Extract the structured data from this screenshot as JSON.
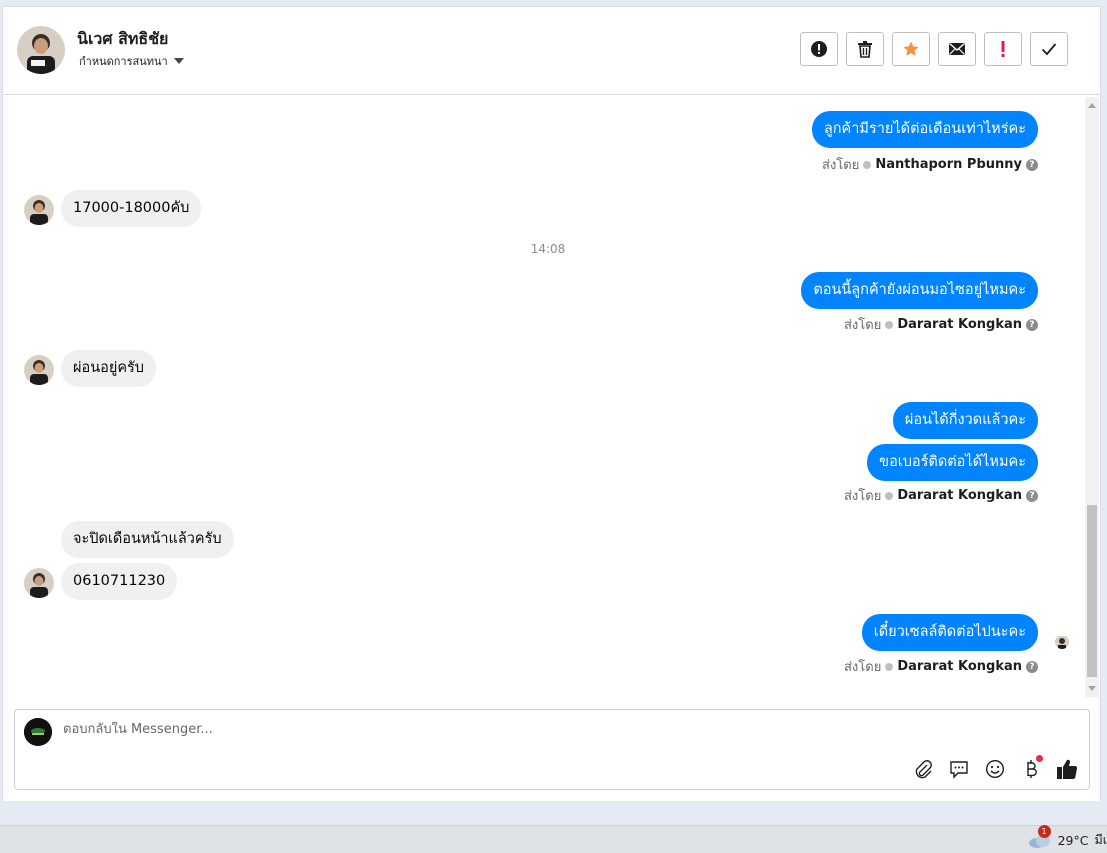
{
  "header": {
    "contact_name": "นิเวศ สิทธิชัย",
    "assign_label": "กำหนดการสนทนา",
    "actions": [
      {
        "name": "spam-report-button",
        "icon": "exclamation-circle-icon"
      },
      {
        "name": "delete-button",
        "icon": "trash-icon"
      },
      {
        "name": "star-button",
        "icon": "star-icon"
      },
      {
        "name": "mark-unread-button",
        "icon": "envelope-icon"
      },
      {
        "name": "follow-up-button",
        "icon": "exclamation-icon"
      },
      {
        "name": "mark-done-button",
        "icon": "check-icon"
      }
    ]
  },
  "messages": {
    "m1": {
      "text": "ลูกค้ามีรายได้ต่อเดือนเท่าไหร่คะ",
      "sent_prefix": "ส่งโดย",
      "sender": "Nanthaporn Pbunny"
    },
    "m2": {
      "text": "17000-18000คับ"
    },
    "time1": "14:08",
    "m3": {
      "text": "ตอนนี้ลูกค้ายังผ่อนมอไซอยู่ไหมคะ",
      "sent_prefix": "ส่งโดย",
      "sender": "Dararat Kongkan"
    },
    "m4": {
      "text": "ผ่อนอยู่ครับ"
    },
    "m5a": {
      "text": "ผ่อนได้กี่งวดแล้วคะ"
    },
    "m5b": {
      "text": "ขอเบอร์ติดต่อได้ไหมคะ",
      "sent_prefix": "ส่งโดย",
      "sender": "Dararat Kongkan"
    },
    "m6a": {
      "text": "จะปิดเดือนหน้าแล้วครับ"
    },
    "m6b": {
      "text": "0610711230"
    },
    "m7": {
      "text": "เดี๋ยวเซลล์ติดต่อไปนะคะ",
      "sent_prefix": "ส่งโดย",
      "sender": "Dararat Kongkan"
    }
  },
  "composer": {
    "placeholder": "ตอบกลับใน Messenger...",
    "tools": [
      "attachment-icon",
      "saved-reply-icon",
      "emoji-icon",
      "baht-payment-icon",
      "thumbs-up-icon"
    ]
  },
  "taskbar": {
    "weather_badge": "1",
    "temperature": "29°C",
    "weather_text": "มีเ"
  },
  "colors": {
    "accent": "#0084ff",
    "incoming_bubble": "#f0f0f0",
    "star": "#f7923a",
    "alert": "#e41e3f"
  }
}
